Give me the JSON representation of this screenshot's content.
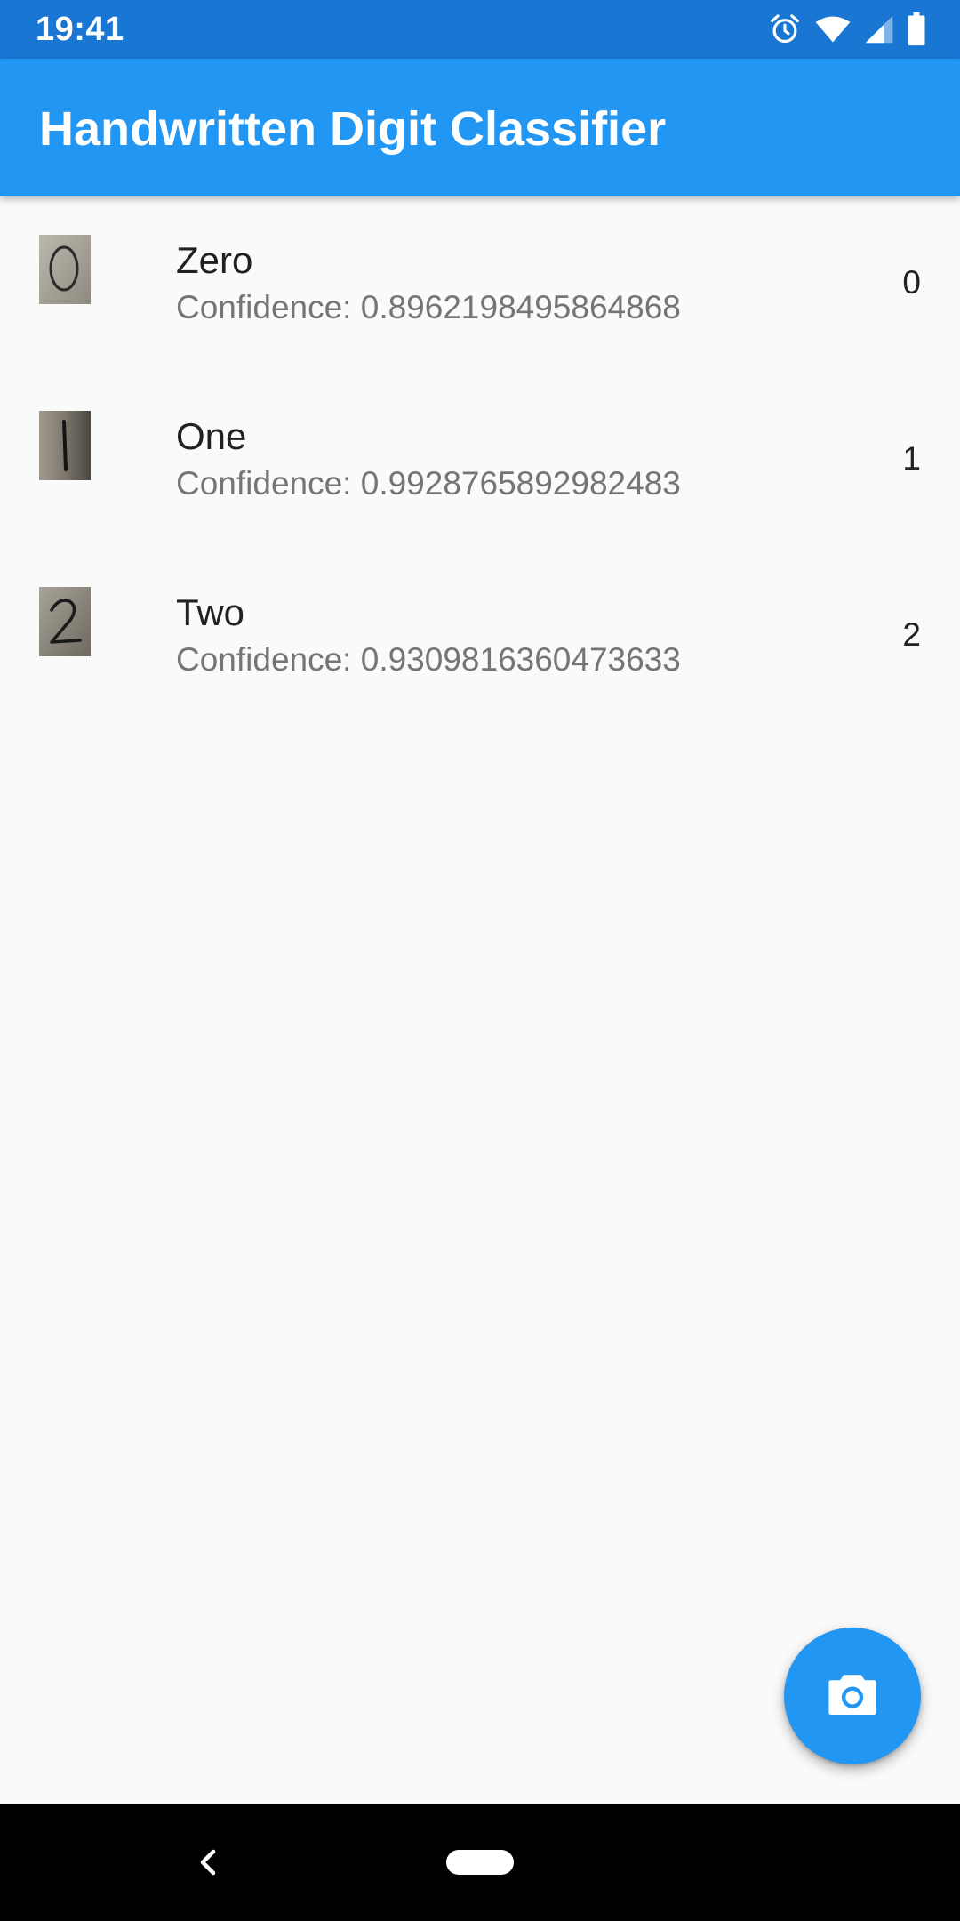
{
  "status_bar": {
    "time": "19:41",
    "icons": [
      "alarm-icon",
      "wifi-icon",
      "cell-signal-icon",
      "battery-icon"
    ]
  },
  "app_bar": {
    "title": "Handwritten Digit Classifier"
  },
  "list": {
    "items": [
      {
        "thumbnail": "handwritten-zero-image",
        "title": "Zero",
        "subtitle": "Confidence: 0.8962198495864868",
        "trailing": "0"
      },
      {
        "thumbnail": "handwritten-one-image",
        "title": "One",
        "subtitle": "Confidence: 0.9928765892982483",
        "trailing": "1"
      },
      {
        "thumbnail": "handwritten-two-image",
        "title": "Two",
        "subtitle": "Confidence: 0.9309816360473633",
        "trailing": "2"
      }
    ]
  },
  "fab": {
    "icon": "camera-icon"
  },
  "nav_bar": {
    "icons": [
      "back-icon",
      "home-pill-icon"
    ]
  },
  "colors": {
    "status_bar": "#1976d2",
    "primary": "#2196f3",
    "background": "#fafafa",
    "title_text": "#212121",
    "subtitle_text": "#757575"
  }
}
